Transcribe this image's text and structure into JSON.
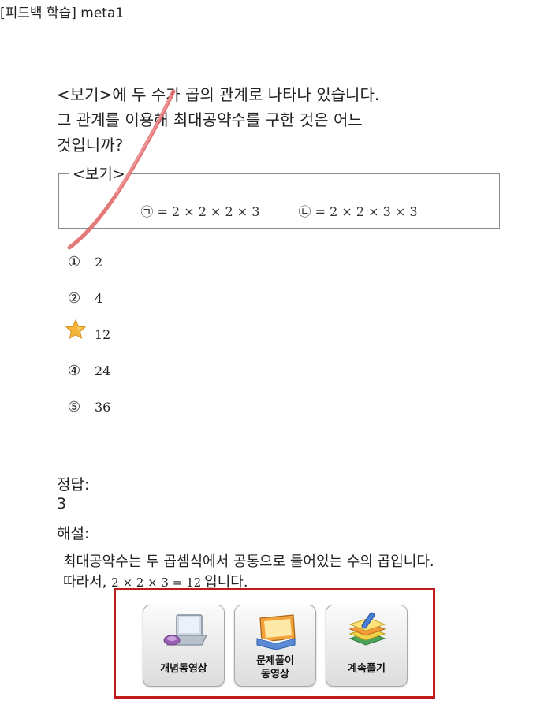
{
  "page_title": "[피드백 학습] meta1",
  "question": {
    "lines": [
      "<보기>에 두 수가 곱의 관계로 나타나 있습니다.",
      "그 관계를 이용해 최대공약수를 구한 것은 어느",
      "것입니까?"
    ]
  },
  "example_box": {
    "label": "<보기>",
    "left_expr": "㉠ = 2 × 2 × 2 × 3",
    "right_expr": "㉡ = 2 × 2 × 3 × 3"
  },
  "choices": [
    {
      "num": "①",
      "value": "2"
    },
    {
      "num": "②",
      "value": "4"
    },
    {
      "num": "③",
      "value": "12"
    },
    {
      "num": "④",
      "value": "24"
    },
    {
      "num": "⑤",
      "value": "36"
    }
  ],
  "selected_choice_marker": "star-icon",
  "answer_label": "정답:",
  "answer_value": "3",
  "explanation_label": "해설:",
  "explanation": {
    "line1": "최대공약수는 두 곱셈식에서 공통으로 들어있는 수의 곱입니다.",
    "line2_prefix": "따라서,",
    "line2_math": "2 × 2 × 3 = 12",
    "line2_suffix": "입니다."
  },
  "buttons": [
    {
      "label": "개념동영상",
      "icon": "laptop-icon"
    },
    {
      "label_line1": "문제풀이",
      "label_line2": "동영상",
      "icon": "open-book-icon"
    },
    {
      "label": "계속풀기",
      "icon": "notepad-pencil-icon"
    }
  ],
  "colors": {
    "panel_border": "#c01a1a",
    "slash_mark": "#e06a6a",
    "star": "#f4b53a"
  }
}
